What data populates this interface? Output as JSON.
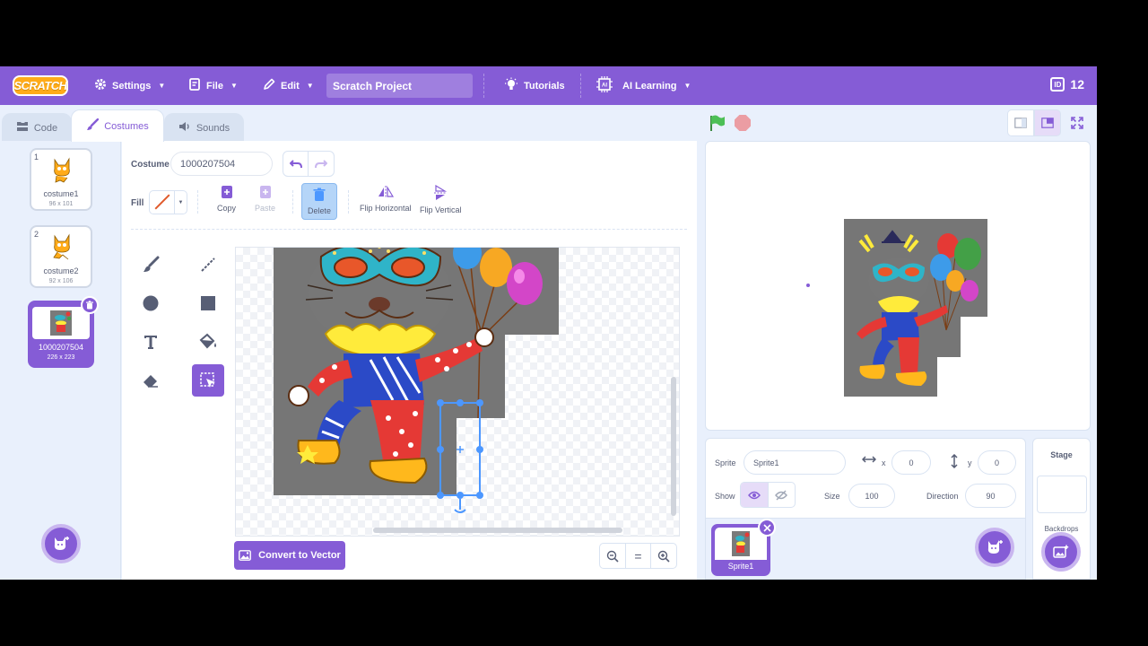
{
  "menubar": {
    "logo": "SCRATCH",
    "settings": "Settings",
    "file": "File",
    "edit": "Edit",
    "project_title": "Scratch Project",
    "tutorials": "Tutorials",
    "ai_learning": "AI Learning",
    "id_icon_text": "ID",
    "id_value": "12"
  },
  "tabs": {
    "code": "Code",
    "costumes": "Costumes",
    "sounds": "Sounds"
  },
  "costumes": [
    {
      "num": "1",
      "name": "costume1",
      "size": "96 x 101"
    },
    {
      "num": "2",
      "name": "costume2",
      "size": "92 x 106"
    },
    {
      "num": "3",
      "name": "1000207504",
      "size": "226 x 223"
    }
  ],
  "editor": {
    "costume_label": "Costume",
    "costume_name": "1000207504",
    "fill_label": "Fill",
    "copy": "Copy",
    "paste": "Paste",
    "delete": "Delete",
    "flip_horizontal": "Flip Horizontal",
    "flip_vertical": "Flip Vertical",
    "convert_to_vector": "Convert to Vector",
    "zoom_reset": "="
  },
  "sprite_info": {
    "sprite_label": "Sprite",
    "sprite_name": "Sprite1",
    "x_label": "x",
    "x_value": "0",
    "y_label": "y",
    "y_value": "0",
    "show_label": "Show",
    "size_label": "Size",
    "size_value": "100",
    "direction_label": "Direction",
    "direction_value": "90"
  },
  "sprite_tile": {
    "name": "Sprite1"
  },
  "stage_pane": {
    "title": "Stage",
    "backdrops": "Backdrops"
  },
  "colors": {
    "menubar": "#855cd6",
    "accent": "#855cd6",
    "logo": "#ffab19",
    "app_bg": "#e9f0fc",
    "flag": "#4cbf56",
    "stop": "#ec5959",
    "selection": "#4c97ff"
  }
}
